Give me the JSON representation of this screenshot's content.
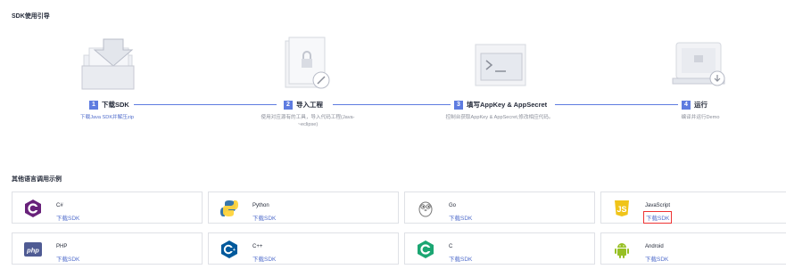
{
  "section_title": "SDK使用引导",
  "steps": [
    {
      "num": "1",
      "label": "下载SDK",
      "desc": "下载Java SDK并解压zip",
      "desc_link": true
    },
    {
      "num": "2",
      "label": "导入工程",
      "desc": "使用对应源有的工具，导入代码工程(Java-~eclipse)",
      "desc_link": false
    },
    {
      "num": "3",
      "label": "填写AppKey & AppSecret",
      "desc": "控制台获取AppKey & AppSecret,修改相应代码。",
      "desc_link": false
    },
    {
      "num": "4",
      "label": "运行",
      "desc": "编译并运行Demo",
      "desc_link": false
    }
  ],
  "other_title": "其他语言调用示例",
  "download_label": "下载SDK",
  "languages": [
    {
      "name": "C#",
      "icon": "csharp-icon",
      "color": "#68217a"
    },
    {
      "name": "Python",
      "icon": "python-icon",
      "color": "#3776ab"
    },
    {
      "name": "Go",
      "icon": "go-gopher-icon",
      "color": "#888888"
    },
    {
      "name": "JavaScript",
      "icon": "javascript-icon",
      "color": "#f0db4f"
    },
    {
      "name": "PHP",
      "icon": "php-icon",
      "color": "#4f5b93"
    },
    {
      "name": "C++",
      "icon": "cplusplus-icon",
      "color": "#00599c"
    },
    {
      "name": "C",
      "icon": "c-icon",
      "color": "#1ba672"
    },
    {
      "name": "Android",
      "icon": "android-icon",
      "color": "#97c024"
    }
  ]
}
